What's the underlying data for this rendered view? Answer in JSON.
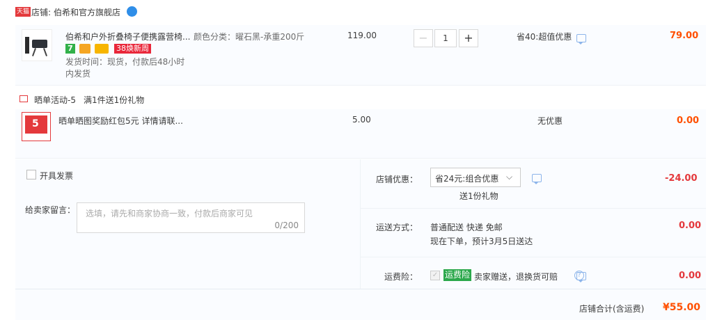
{
  "shop": {
    "badge": "天猫",
    "label": "店铺:",
    "name": "伯希和官方旗舰店"
  },
  "item1": {
    "title": "伯希和户外折叠椅子便携露营椅...",
    "spec": "颜色分类：曜石黑-承重200斤",
    "tag_38": "38焕新周",
    "delivery_line1": "发货时间：现货，付款后48小时",
    "delivery_line2": "内发货",
    "price": "119.00",
    "qty": "1",
    "discount": "省40:超值优惠",
    "total": "79.00"
  },
  "gift_activity": {
    "label": "晒单活动-5",
    "desc": "满1件送1份礼物"
  },
  "item2": {
    "thumb_number": "5",
    "title": "晒单晒图奖励红包5元 详情请联...",
    "price": "5.00",
    "discount": "无优惠",
    "total": "0.00"
  },
  "invoice": {
    "label": "开具发票"
  },
  "message": {
    "label": "给卖家留言：",
    "placeholder": "选填，请先和商家协商一致，付款后商家可见",
    "counter": "0/200"
  },
  "promo": {
    "label": "店铺优惠：",
    "selected": "省24元:组合优惠",
    "gift_note": "送1份礼物",
    "amount": "-24.00"
  },
  "shipping": {
    "label": "运送方式：",
    "method": "普通配送 快递 免邮",
    "eta": "现在下单，预计3月5日送达",
    "amount": "0.00"
  },
  "insurance": {
    "label": "运费险：",
    "tag": "运费险",
    "desc": "卖家赠送，退换货可赔",
    "amount": "0.00"
  },
  "summary": {
    "label": "店铺合计(含运费)",
    "total": "¥55.00"
  },
  "colors": {
    "orange": "#ff5000",
    "red": "#e4393c",
    "insurance_green": "#2ca84c"
  }
}
